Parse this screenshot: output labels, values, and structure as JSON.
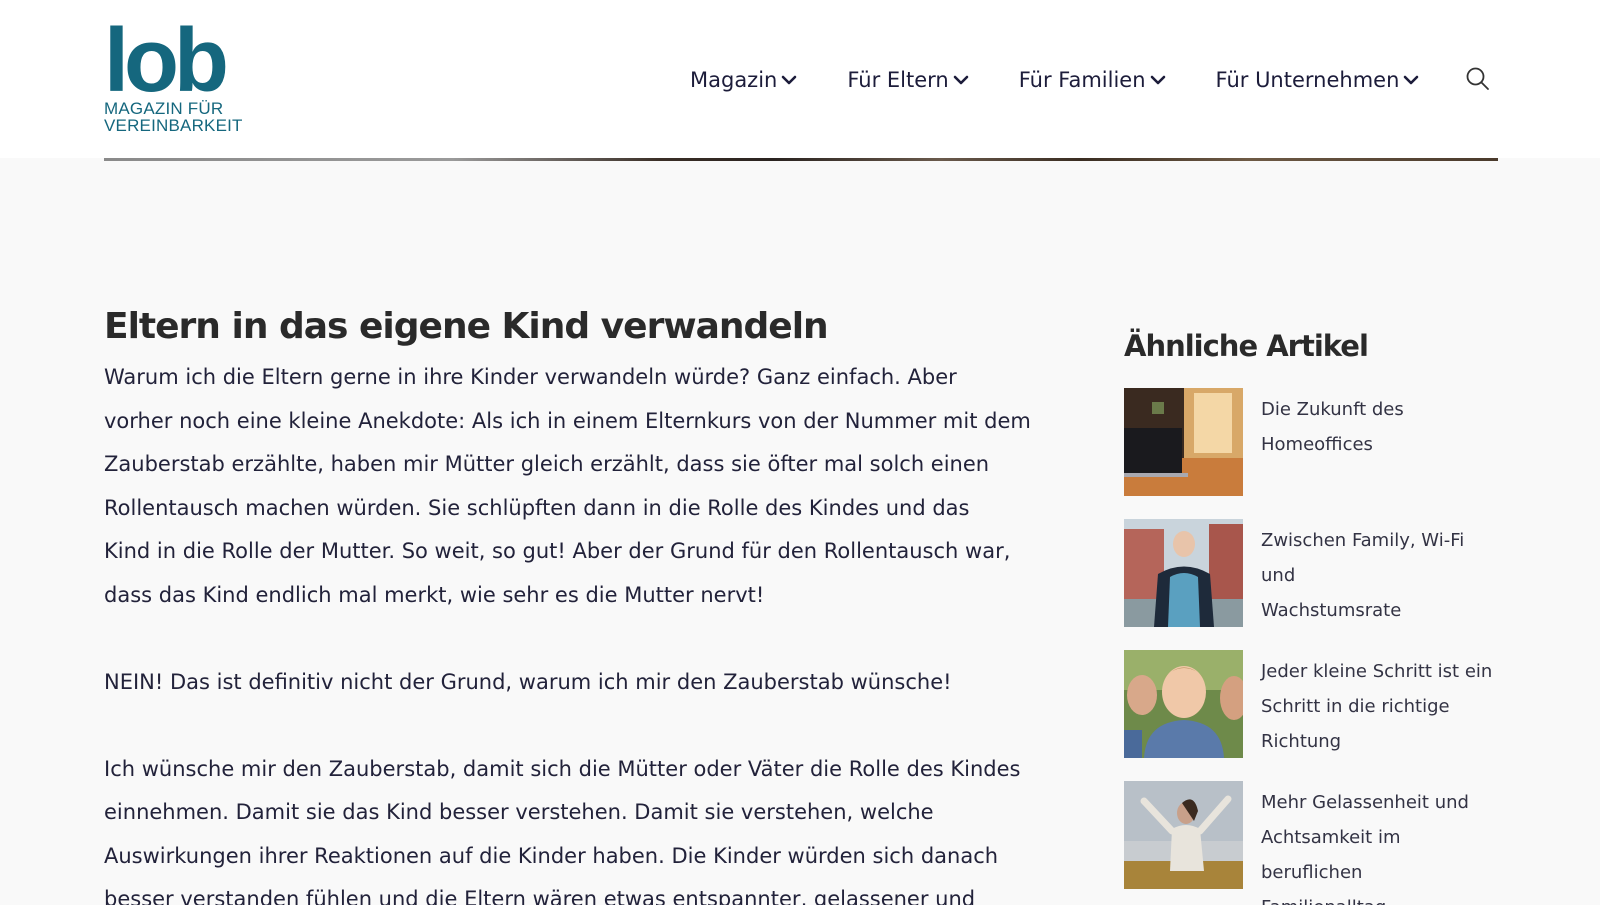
{
  "logo": {
    "mark": "lob",
    "tagline_1": "MAGAZIN FÜR",
    "tagline_2": "VEREINBARKEIT"
  },
  "nav": {
    "items": [
      {
        "label": "Magazin"
      },
      {
        "label": "Für Eltern"
      },
      {
        "label": "Für Familien"
      },
      {
        "label": "Für Unternehmen"
      }
    ],
    "search_icon": "search-icon"
  },
  "article": {
    "title": "Eltern in das eigene Kind verwandeln",
    "lines": [
      "Warum ich die Eltern gerne in ihre Kinder verwandeln würde? Ganz einfach. Aber",
      "vorher noch eine kleine Anekdote: Als ich in einem Elternkurs von der Nummer mit dem",
      "Zauberstab erzählte, haben mir Mütter gleich erzählt, dass sie öfter mal solch einen",
      "Rollentausch machen würden. Sie schlüpften dann in die Rolle des Kindes und das",
      "Kind in die Rolle der Mutter. So weit, so gut! Aber der Grund für den Rollentausch war,",
      "dass das Kind endlich mal merkt, wie sehr es die Mutter nervt!",
      "NEIN! Das ist definitiv nicht der Grund, warum ich mir den Zauberstab wünsche!",
      "Ich wünsche mir den Zauberstab, damit sich die Mütter oder Väter die Rolle des Kindes",
      "einnehmen. Damit sie das Kind besser verstehen. Damit sie verstehen, welche",
      "Auswirkungen ihrer Reaktionen auf die Kinder haben. Die Kinder würden sich danach",
      "besser verstanden fühlen und die Eltern wären etwas entspannter, gelassener und"
    ]
  },
  "sidebar": {
    "title": "Ähnliche Artikel",
    "items": [
      {
        "line1": "Die Zukunft des",
        "line2": "Homeoffices",
        "line3": ""
      },
      {
        "line1": "Zwischen Family, Wi-Fi und",
        "line2": "Wachstumsrate",
        "line3": ""
      },
      {
        "line1": "Jeder kleine Schritt ist ein",
        "line2": "Schritt in die richtige",
        "line3": "Richtung"
      },
      {
        "line1": "Mehr Gelassenheit und",
        "line2": "Achtsamkeit im beruflichen",
        "line3": "Familienalltag"
      }
    ]
  },
  "colors": {
    "brand": "#15677e",
    "background": "#f9f9f9",
    "header": "#ffffff",
    "text": "#22223a"
  }
}
